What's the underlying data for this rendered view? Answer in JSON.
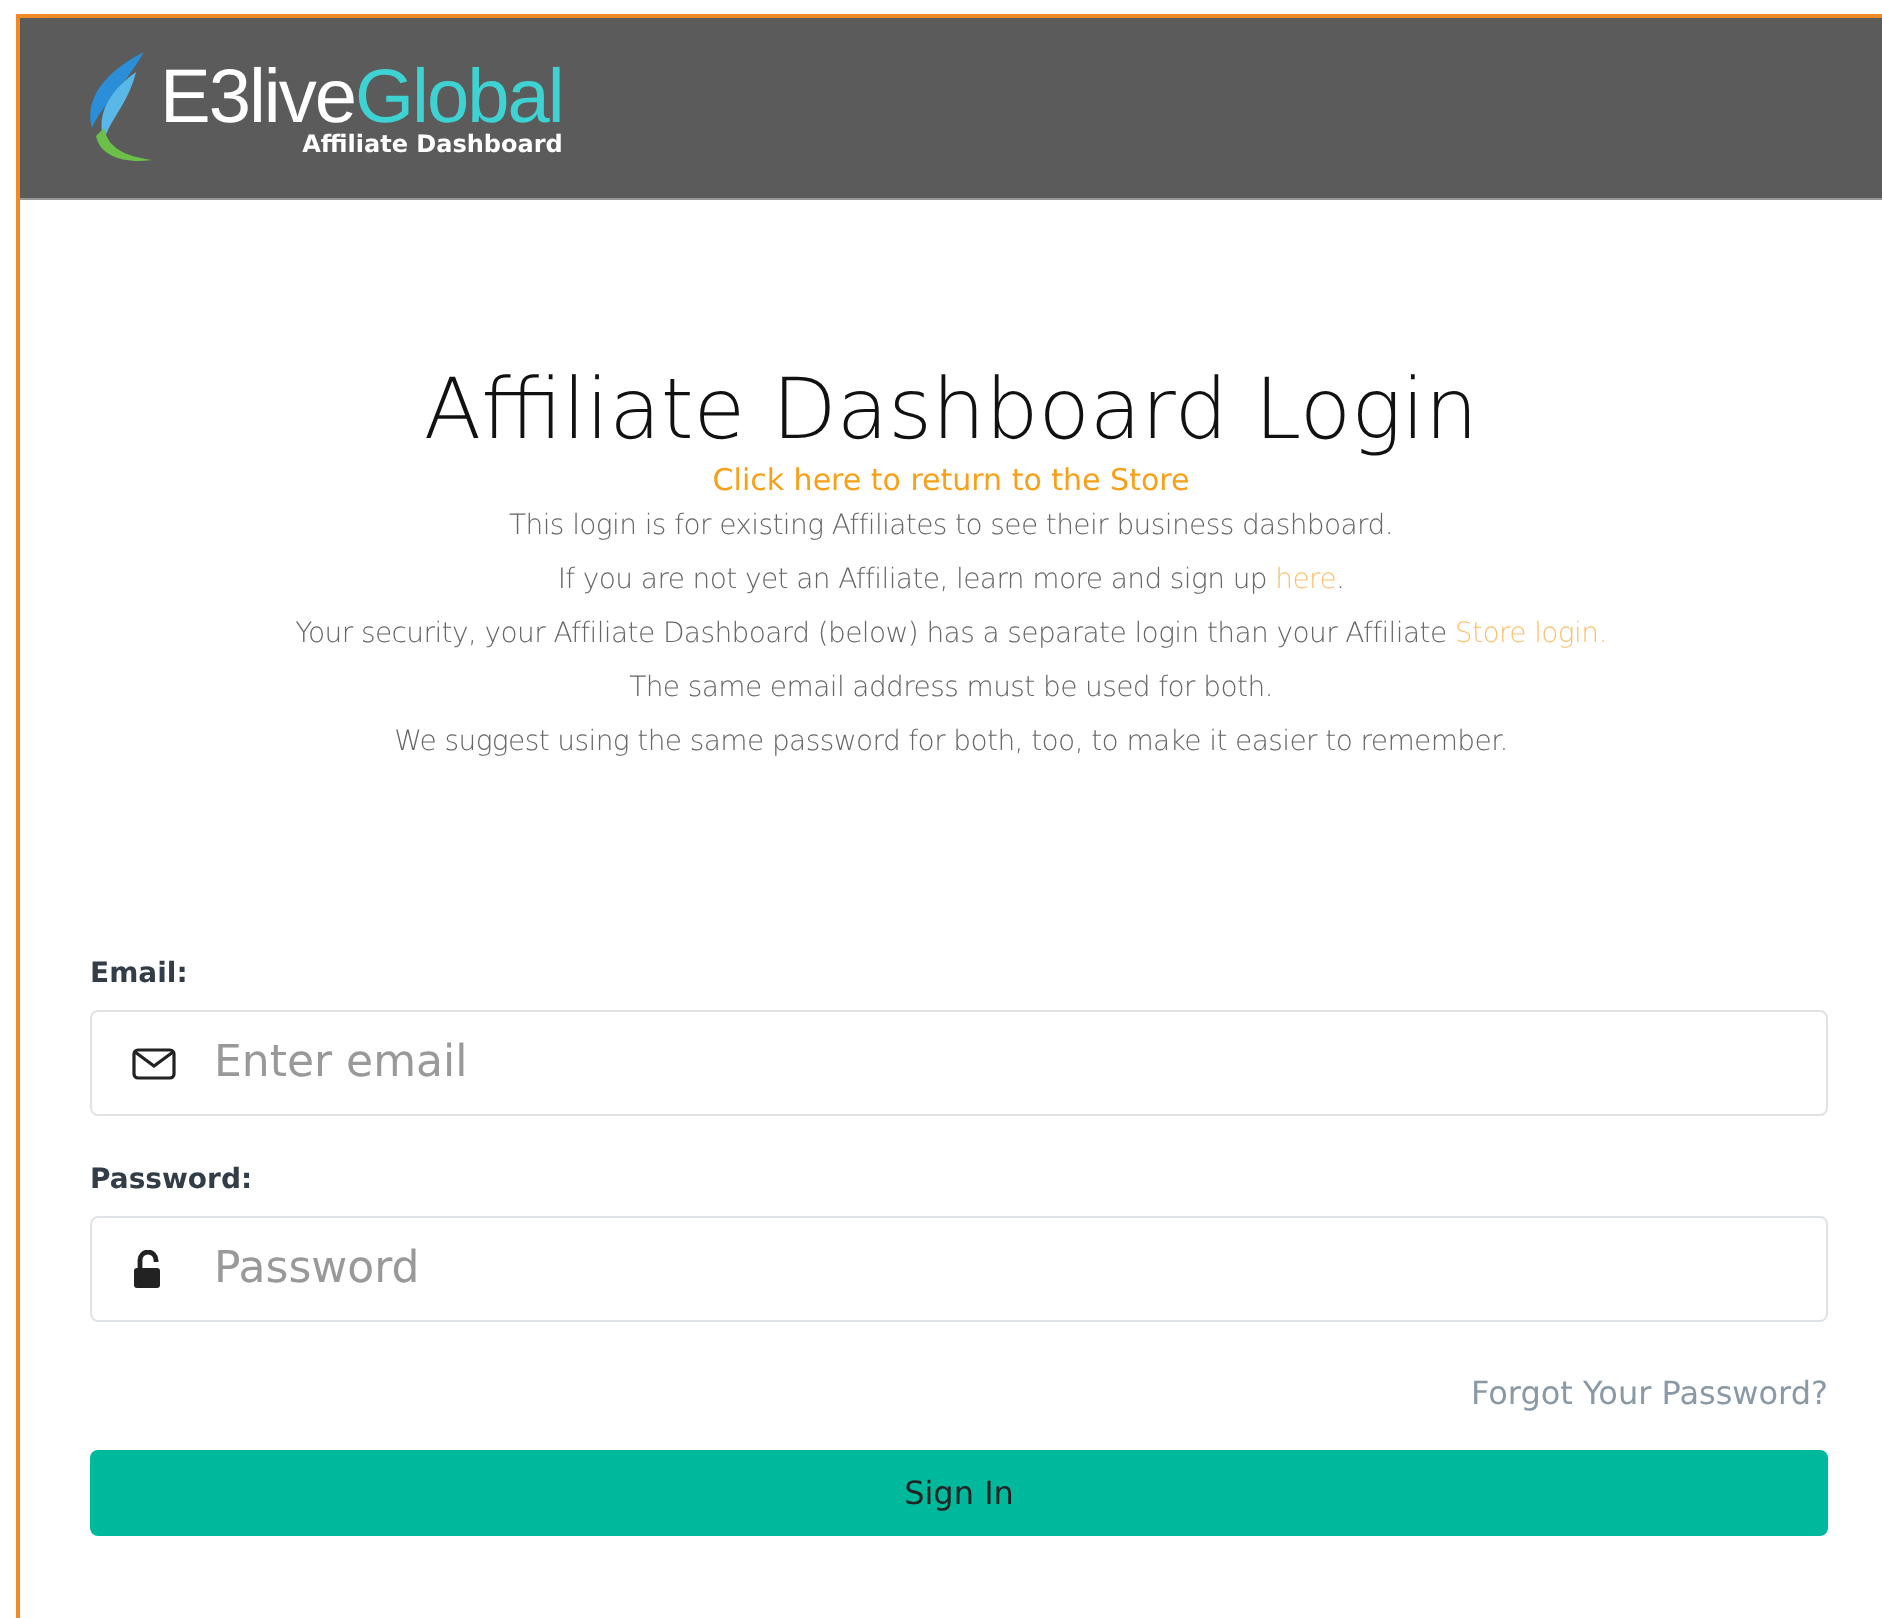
{
  "header": {
    "logo": {
      "brand_main": "E3live",
      "brand_accent": "Global",
      "subtitle": "Affiliate Dashboard"
    }
  },
  "title": "Affiliate Dashboard Login",
  "store_link": "Click here to return to the Store",
  "intro_lines": [
    {
      "parts": [
        {
          "kind": "text",
          "text": "This login is for existing Affiliates to see their business dashboard."
        }
      ]
    },
    {
      "parts": [
        {
          "kind": "text",
          "text": "If you are not yet an Affiliate, learn more and sign up "
        },
        {
          "kind": "link",
          "text": "here"
        },
        {
          "kind": "text",
          "text": "."
        }
      ]
    },
    {
      "parts": [
        {
          "kind": "text",
          "text": "Your security, your Affiliate Dashboard (below) has a separate login than your Affiliate "
        },
        {
          "kind": "link",
          "text": "Store login."
        }
      ]
    },
    {
      "parts": [
        {
          "kind": "text",
          "text": "The same email address must be used for both."
        }
      ]
    },
    {
      "parts": [
        {
          "kind": "text",
          "text": "We suggest using the same password for both, too, to make it easier to remember."
        }
      ]
    }
  ],
  "fields": [
    {
      "kind": "email",
      "label": "Email:",
      "placeholder": "Enter email"
    },
    {
      "kind": "password",
      "label": "Password:",
      "placeholder": "Password"
    }
  ],
  "forgot_link": "Forgot Your Password?",
  "submit_button": "Sign In"
}
